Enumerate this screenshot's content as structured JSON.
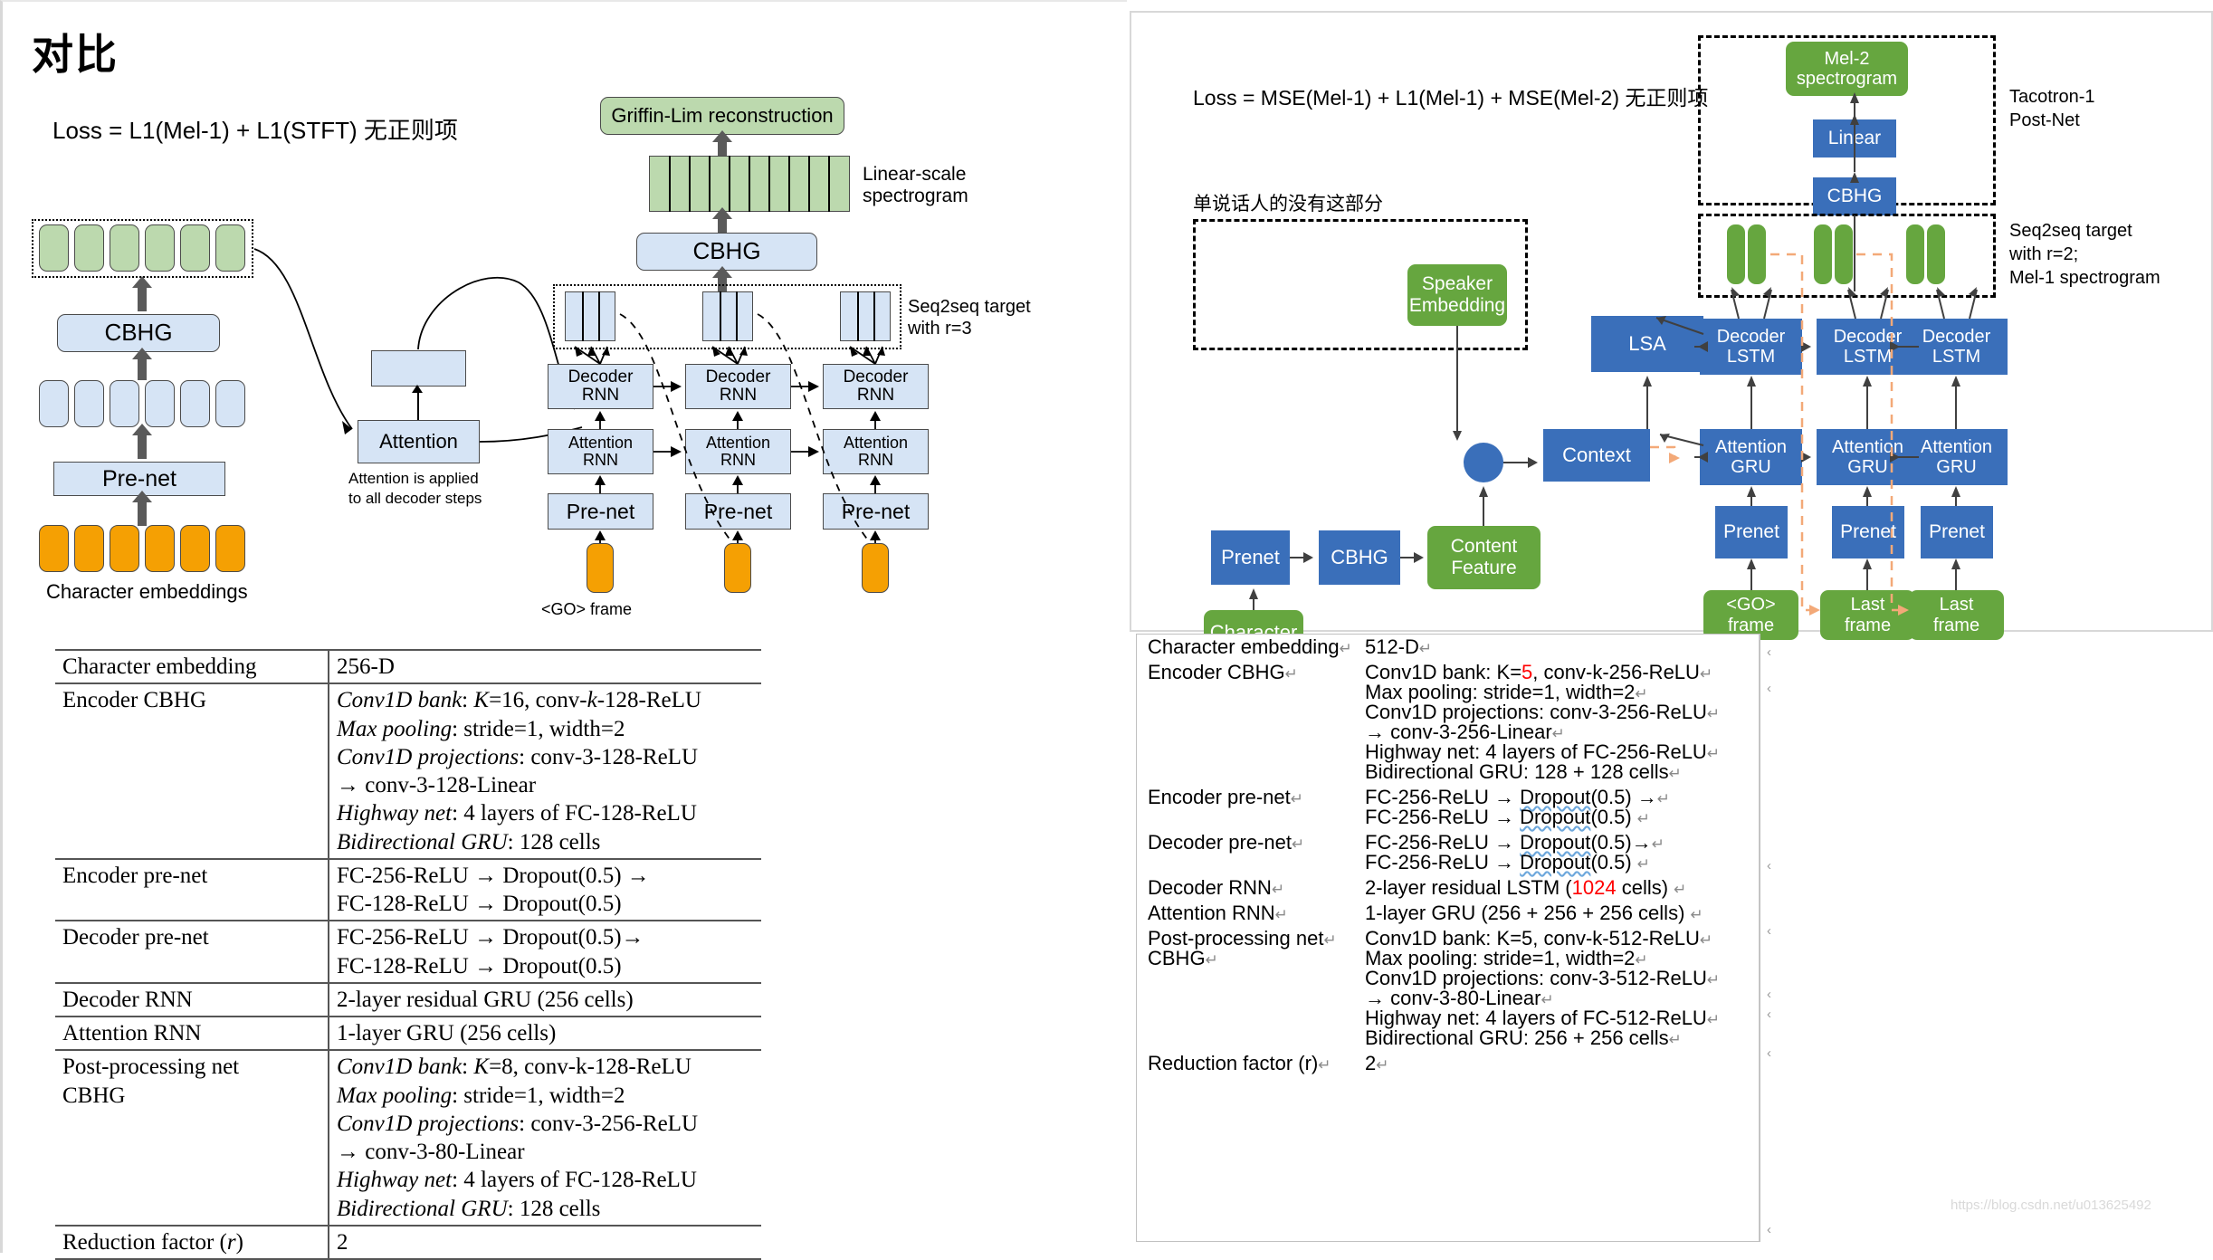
{
  "slide": {
    "title": "对比",
    "left_loss": "Loss = L1(Mel-1) + L1(STFT) 无正则项",
    "right_loss": "Loss = MSE(Mel-1) + L1(Mel-1) + MSE(Mel-2)  无正则项",
    "right_note": "单说话人的没有这部分"
  },
  "left_diagram": {
    "griffin_lim": "Griffin-Lim reconstruction",
    "linear_spec_label": "Linear-scale\nspectrogram",
    "linear_spec_line1": "Linear-scale",
    "linear_spec_line2": "spectrogram",
    "post_cbhg": "CBHG",
    "seq2seq_label_line1": "Seq2seq target",
    "seq2seq_label_line2": "with r=3",
    "encoder_cbhg": "CBHG",
    "encoder_prenet": "Pre-net",
    "char_embeddings": "Character embeddings",
    "attention": "Attention",
    "attention_note_line1": "Attention is applied",
    "attention_note_line2": "to all decoder steps",
    "decoder_rnn_line1": "Decoder",
    "decoder_rnn_line2": "RNN",
    "attention_rnn_line1": "Attention",
    "attention_rnn_line2": "RNN",
    "decoder_prenet": "Pre-net",
    "go_frame": "<GO> frame",
    "columns": [
      {
        "decoder": "Decoder RNN",
        "attn": "Attention RNN",
        "prenet": "Pre-net"
      },
      {
        "decoder": "Decoder RNN",
        "attn": "Attention RNN",
        "prenet": "Pre-net"
      },
      {
        "decoder": "Decoder RNN",
        "attn": "Attention RNN",
        "prenet": "Pre-net"
      }
    ]
  },
  "right_diagram": {
    "mel2_line1": "Mel-2",
    "mel2_line2": "spectrogram",
    "linear": "Linear",
    "cbhg_post": "CBHG",
    "postnet_label_line1": "Tacotron-1",
    "postnet_label_line2": "Post-Net",
    "seq2seq_label_line1": "Seq2seq target",
    "seq2seq_label_line2": "with r=2;",
    "seq2seq_label_line3": "Mel-1 spectrogram",
    "speaker_embedding_line1": "Speaker",
    "speaker_embedding_line2": "Embedding",
    "context": "Context",
    "lsa": "LSA",
    "prenet_enc": "Prenet",
    "cbhg_enc": "CBHG",
    "content_feature_line1": "Content",
    "content_feature_line2": "Feature",
    "character": "Character",
    "decoder_lstm_line1": "Decoder",
    "decoder_lstm_line2": "LSTM",
    "attention_gru_line1": "Attention",
    "attention_gru_line2": "GRU",
    "prenet": "Prenet",
    "go_frame_line1": "<GO>",
    "go_frame_line2": "frame",
    "last_frame_line1": "Last",
    "last_frame_line2": "frame",
    "columns": [
      {
        "decoder": "Decoder LSTM",
        "attn": "Attention GRU",
        "prenet": "Prenet",
        "input": "<GO> frame"
      },
      {
        "decoder": "Decoder LSTM",
        "attn": "Attention GRU",
        "prenet": "Prenet",
        "input": "Last frame"
      },
      {
        "decoder": "Decoder LSTM",
        "attn": "Attention GRU",
        "prenet": "Prenet",
        "input": "Last frame"
      }
    ]
  },
  "left_table": {
    "rows": [
      {
        "key": "Character embedding",
        "lines": [
          "256-D"
        ]
      },
      {
        "key": "Encoder CBHG",
        "lines": [
          "Conv1D bank: K=16, conv-k-128-ReLU",
          "Max pooling: stride=1, width=2",
          "Conv1D projections: conv-3-128-ReLU",
          "→ conv-3-128-Linear",
          "Highway net: 4 layers of FC-128-ReLU",
          "Bidirectional GRU: 128 cells"
        ]
      },
      {
        "key": "Encoder pre-net",
        "lines": [
          "FC-256-ReLU → Dropout(0.5) →",
          "FC-128-ReLU → Dropout(0.5)"
        ]
      },
      {
        "key": "Decoder pre-net",
        "lines": [
          "FC-256-ReLU → Dropout(0.5)→",
          "FC-128-ReLU → Dropout(0.5)"
        ]
      },
      {
        "key": "Decoder RNN",
        "lines": [
          "2-layer residual GRU (256 cells)"
        ]
      },
      {
        "key": "Attention RNN",
        "lines": [
          "1-layer GRU (256 cells)"
        ]
      },
      {
        "key": "Post-processing net CBHG",
        "lines": [
          "Conv1D bank: K=8, conv-k-128-ReLU",
          "Max pooling: stride=1, width=2",
          "Conv1D projections: conv-3-256-ReLU",
          "→ conv-3-80-Linear",
          "Highway net: 4 layers of FC-128-ReLU",
          "Bidirectional GRU: 128 cells"
        ]
      },
      {
        "key": "Reduction factor (r)",
        "lines": [
          "2"
        ]
      }
    ]
  },
  "right_table": {
    "rows": [
      {
        "key": "Character embedding",
        "lines": [
          "512-D"
        ]
      },
      {
        "key": "Encoder CBHG",
        "lines": [
          "Conv1D bank: K=5, conv-k-256-ReLU",
          "Max pooling: stride=1, width=2",
          "Conv1D projections: conv-3-256-ReLU",
          "→  conv-3-256-Linear",
          "Highway net: 4 layers of FC-256-ReLU",
          "Bidirectional GRU: 128 + 128 cells"
        ]
      },
      {
        "key": "Encoder pre-net",
        "lines": [
          "FC-256-ReLU → Dropout(0.5) →",
          "FC-256-ReLU → Dropout(0.5)"
        ]
      },
      {
        "key": "Decoder pre-net",
        "lines": [
          "FC-256-ReLU → Dropout(0.5)→",
          "FC-256-ReLU → Dropout(0.5)"
        ]
      },
      {
        "key": "Decoder RNN",
        "lines": [
          "2-layer residual LSTM (1024 cells)"
        ]
      },
      {
        "key": "Attention RNN",
        "lines": [
          "1-layer GRU (256 + 256 + 256 cells)"
        ]
      },
      {
        "key": "Post-processing net CBHG",
        "lines": [
          "Conv1D bank: K=5, conv-k-512-ReLU",
          "Max pooling: stride=1, width=2",
          "Conv1D projections: conv-3-512-ReLU",
          "→  conv-3-80-Linear",
          "Highway net: 4 layers of FC-512-ReLU",
          "Bidirectional GRU: 256 + 256 cells"
        ]
      },
      {
        "key": "Reduction factor (r)",
        "lines": [
          "2"
        ]
      }
    ],
    "highlights": {
      "encoder_k": "5",
      "decoder_cells": "1024"
    }
  },
  "watermark": "https://blog.csdn.net/u013625492",
  "colors": {
    "blue_box": "#d6e4f5",
    "green_box": "#bcd9ae",
    "orange_box": "#f5a003",
    "deck_blue": "#3a6fba",
    "deck_green": "#66a63f",
    "accent_orange": "#f3a978",
    "highlight_red": "#ff0000"
  }
}
